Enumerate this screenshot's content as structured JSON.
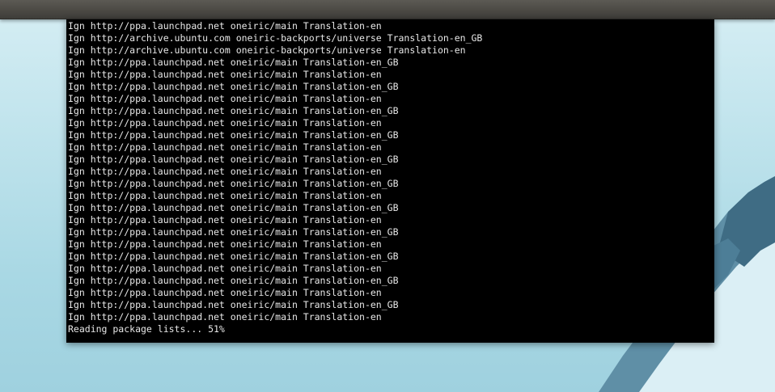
{
  "terminal": {
    "lines": [
      "Ign http://ppa.launchpad.net oneiric/main Translation-en",
      "Ign http://archive.ubuntu.com oneiric-backports/universe Translation-en_GB",
      "Ign http://archive.ubuntu.com oneiric-backports/universe Translation-en",
      "Ign http://ppa.launchpad.net oneiric/main Translation-en_GB",
      "Ign http://ppa.launchpad.net oneiric/main Translation-en",
      "Ign http://ppa.launchpad.net oneiric/main Translation-en_GB",
      "Ign http://ppa.launchpad.net oneiric/main Translation-en",
      "Ign http://ppa.launchpad.net oneiric/main Translation-en_GB",
      "Ign http://ppa.launchpad.net oneiric/main Translation-en",
      "Ign http://ppa.launchpad.net oneiric/main Translation-en_GB",
      "Ign http://ppa.launchpad.net oneiric/main Translation-en",
      "Ign http://ppa.launchpad.net oneiric/main Translation-en_GB",
      "Ign http://ppa.launchpad.net oneiric/main Translation-en",
      "Ign http://ppa.launchpad.net oneiric/main Translation-en_GB",
      "Ign http://ppa.launchpad.net oneiric/main Translation-en",
      "Ign http://ppa.launchpad.net oneiric/main Translation-en_GB",
      "Ign http://ppa.launchpad.net oneiric/main Translation-en",
      "Ign http://ppa.launchpad.net oneiric/main Translation-en_GB",
      "Ign http://ppa.launchpad.net oneiric/main Translation-en",
      "Ign http://ppa.launchpad.net oneiric/main Translation-en_GB",
      "Ign http://ppa.launchpad.net oneiric/main Translation-en",
      "Ign http://ppa.launchpad.net oneiric/main Translation-en_GB",
      "Ign http://ppa.launchpad.net oneiric/main Translation-en",
      "Ign http://ppa.launchpad.net oneiric/main Translation-en_GB",
      "Ign http://ppa.launchpad.net oneiric/main Translation-en",
      "Reading package lists... 51%"
    ]
  },
  "colors": {
    "terminal_background": "#000000",
    "terminal_text": "#e8e8e8",
    "panel": "#4a4843",
    "wallpaper": "#bfe3ec"
  }
}
